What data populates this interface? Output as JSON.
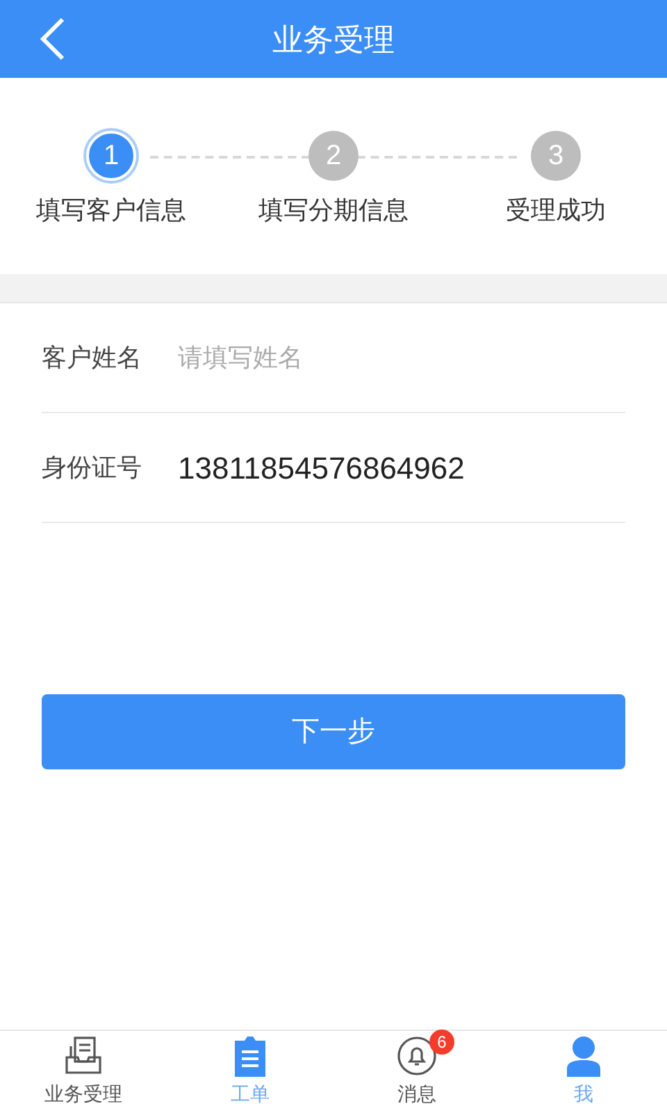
{
  "header": {
    "title": "业务受理"
  },
  "steps": [
    {
      "number": "1",
      "label": "填写客户信息",
      "selected": true
    },
    {
      "number": "2",
      "label": "填写分期信息",
      "selected": false
    },
    {
      "number": "3",
      "label": "受理成功",
      "selected": false
    }
  ],
  "fields": [
    {
      "label": "客户姓名",
      "placeholder": "请填写姓名"
    },
    {
      "label": "身份证号",
      "value": "13811854576864962"
    }
  ],
  "next_button": "下一步",
  "tabs": [
    {
      "kind": "tray",
      "label": "业务受理",
      "selected": false
    },
    {
      "kind": "clipboard",
      "label": "工单",
      "selected": true
    },
    {
      "kind": "bell",
      "label": "消息",
      "selected": false,
      "badge": "6"
    },
    {
      "kind": "person",
      "label": "我",
      "selected": true
    }
  ]
}
